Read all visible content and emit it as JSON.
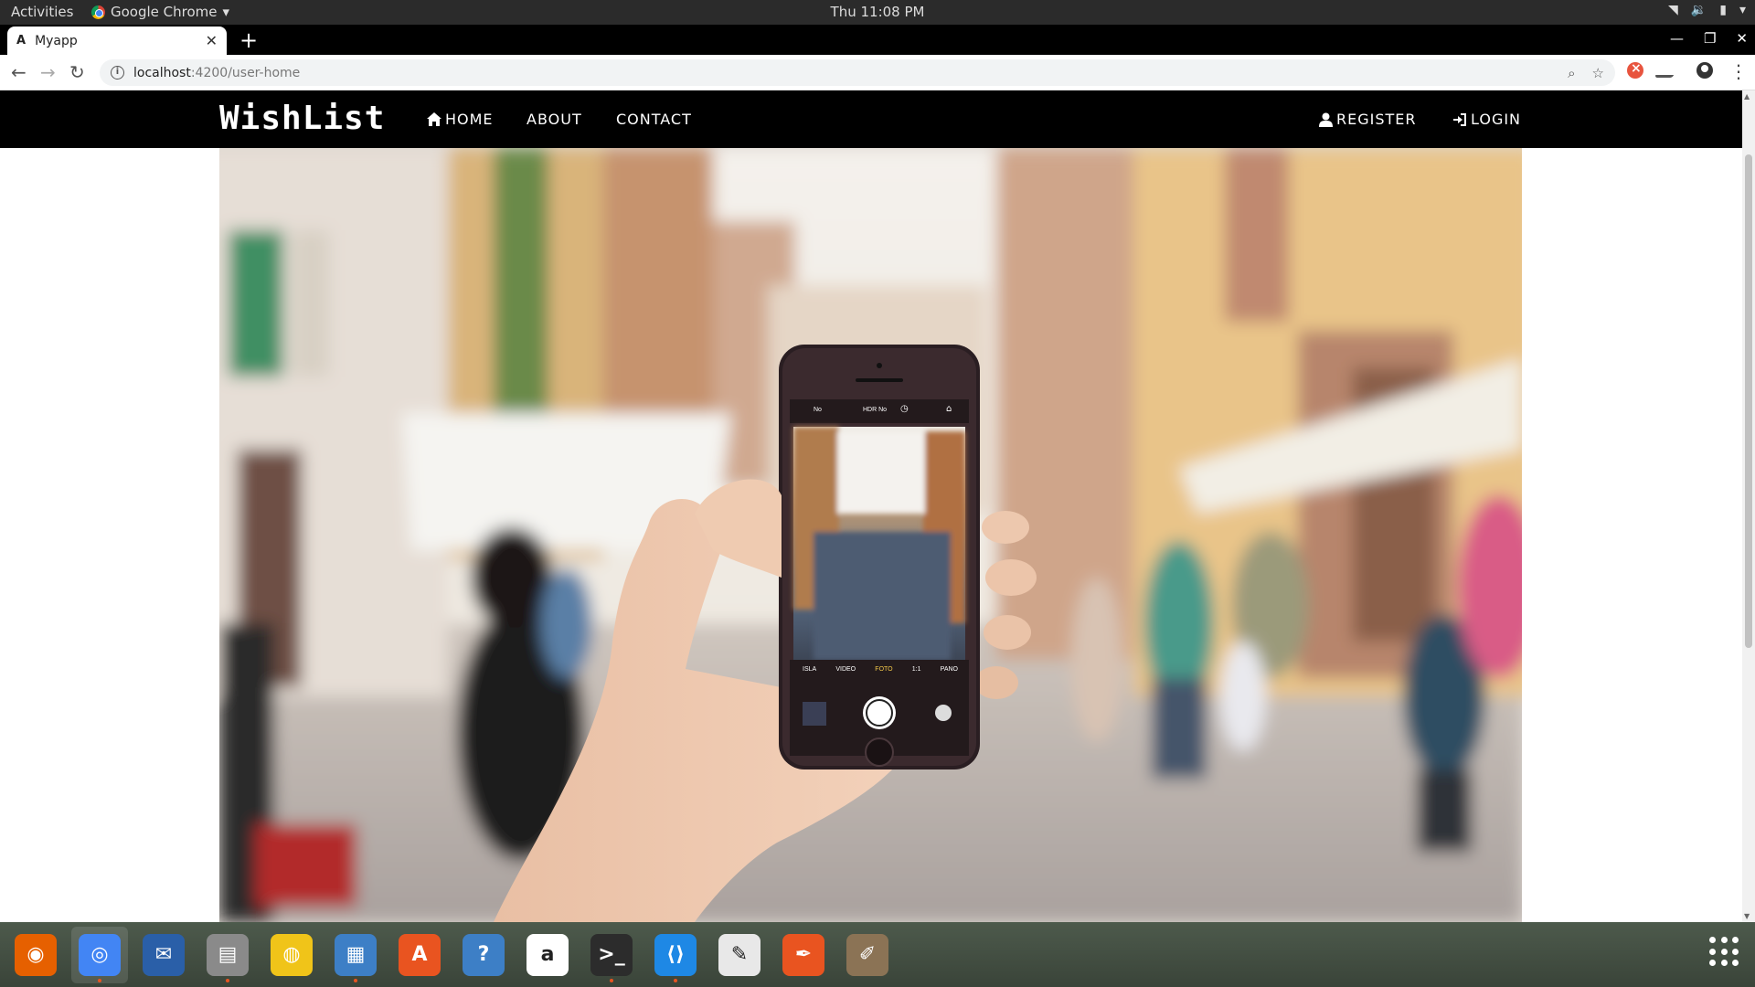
{
  "system_bar": {
    "activities": "Activities",
    "app_name": "Google Chrome",
    "clock": "Thu 11:08 PM"
  },
  "browser": {
    "tab": {
      "favicon": "A",
      "title": "Myapp"
    },
    "url_host": "localhost",
    "url_path": ":4200/user-home"
  },
  "navbar": {
    "brand": "WishList",
    "links": {
      "home": "HOME",
      "about": "ABOUT",
      "contact": "CONTACT"
    },
    "right": {
      "register": "REGISTER",
      "login": "LOGIN"
    },
    "background": "#000000",
    "text_color": "#ffffff"
  },
  "hero": {
    "image_description_icon": "hand-holding-phone-photo-street"
  },
  "phone_screen": {
    "flash": "No",
    "hdr": "HDR No",
    "modes": [
      "ISLA",
      "VIDEO",
      "FOTO",
      "1:1",
      "PANO"
    ]
  },
  "dock": {
    "apps": [
      {
        "name": "firefox-icon",
        "color": "#e66000"
      },
      {
        "name": "chrome-icon",
        "color": "#4285f4",
        "active": true
      },
      {
        "name": "thunderbird-icon",
        "color": "#2a5fa8"
      },
      {
        "name": "files-icon",
        "color": "#8a8a8a"
      },
      {
        "name": "rhythmbox-icon",
        "color": "#f0c419"
      },
      {
        "name": "image-viewer-icon",
        "color": "#3d7fc6"
      },
      {
        "name": "software-center-icon",
        "color": "#e95420"
      },
      {
        "name": "help-icon",
        "color": "#3d7fc6"
      },
      {
        "name": "amazon-icon",
        "color": "#ffffff"
      },
      {
        "name": "terminal-icon",
        "color": "#2c2c2c"
      },
      {
        "name": "vscode-icon",
        "color": "#1e88e5"
      },
      {
        "name": "text-editor-icon",
        "color": "#e8e8e8"
      },
      {
        "name": "inkscape-icon",
        "color": "#e95420"
      },
      {
        "name": "gimp-icon",
        "color": "#8b7355"
      }
    ]
  }
}
